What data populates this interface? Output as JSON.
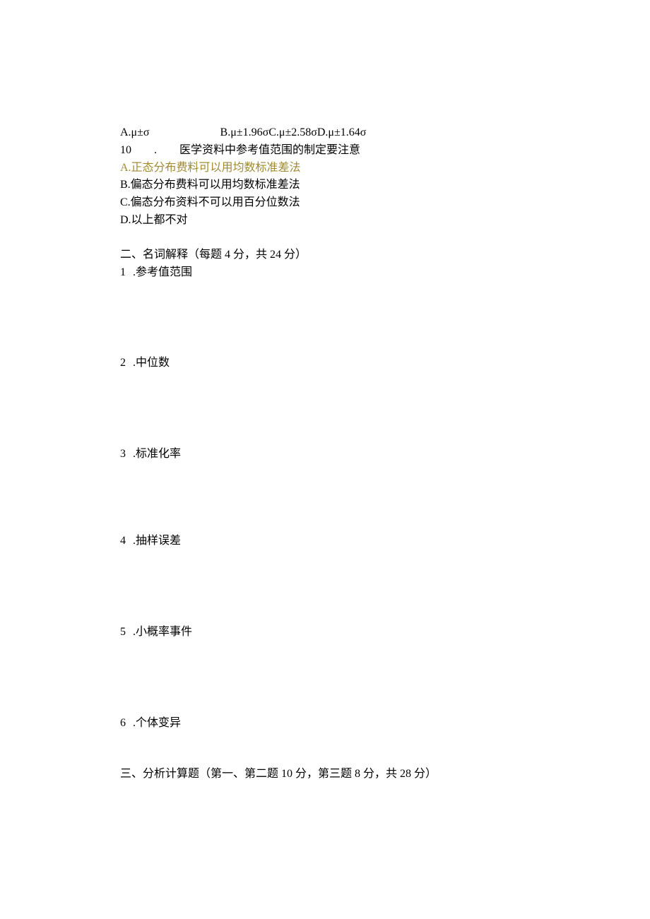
{
  "q9_options": {
    "a": "A.μ±σ",
    "b": "B.μ±1.96σC.μ±2.58σD.μ±1.64σ"
  },
  "q10": {
    "number": "10",
    "dot": ".",
    "stem": "医学资料中参考值范围的制定要注意",
    "opt_a": "A.正态分布费料可以用均数标准差法",
    "opt_b": "B.偏态分布费料可以用均数标准差法",
    "opt_c": "C.偏态分布资料不可以用百分位数法",
    "opt_d": "D.以上都不对"
  },
  "section2": {
    "title": "二、名词解释（每题 4 分，共 24 分）",
    "items": [
      {
        "num": "1",
        "dot": ".参考值范围"
      },
      {
        "num": "2",
        "dot": ".中位数"
      },
      {
        "num": "3",
        "dot": ".标准化率"
      },
      {
        "num": "4",
        "dot": ".抽样误差"
      },
      {
        "num": "5",
        "dot": ".小概率事件"
      },
      {
        "num": "6",
        "dot": ".个体变异"
      }
    ]
  },
  "section3": {
    "title": "三、分析计算题（第一、第二题 10 分，第三题 8 分，共 28 分）"
  }
}
